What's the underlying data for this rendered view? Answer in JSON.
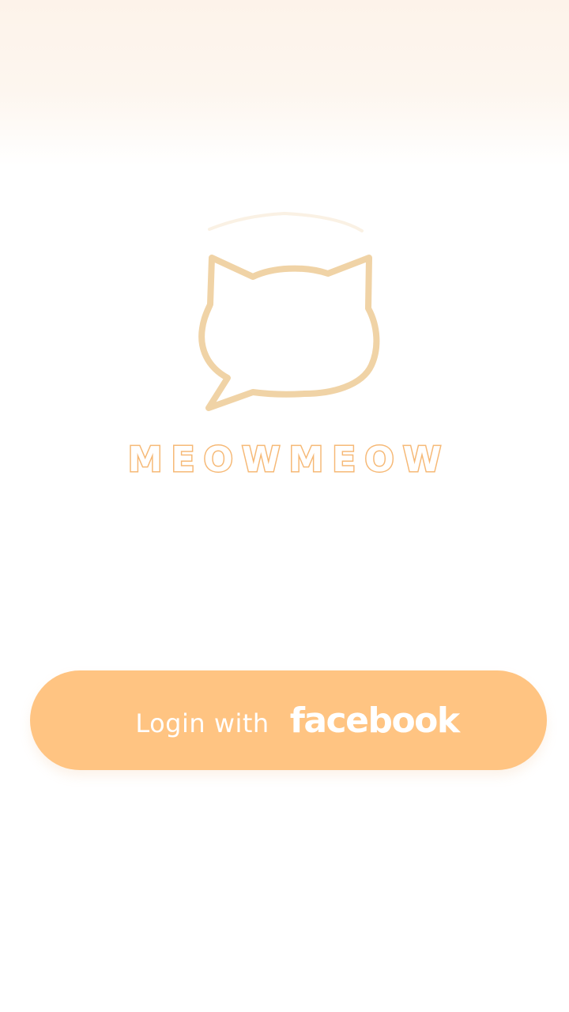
{
  "app": {
    "name": "MEOWMEOW",
    "logo_icon": "cat-speech-bubble-icon"
  },
  "login": {
    "prefix_label": "Login with",
    "brand_label": "facebook"
  },
  "colors": {
    "accent": "#ffc482",
    "logo_stroke": "#f0d3a6",
    "brand_text_stroke": "#f6b874",
    "top_background": "#fdf3ea",
    "background": "#ffffff"
  }
}
